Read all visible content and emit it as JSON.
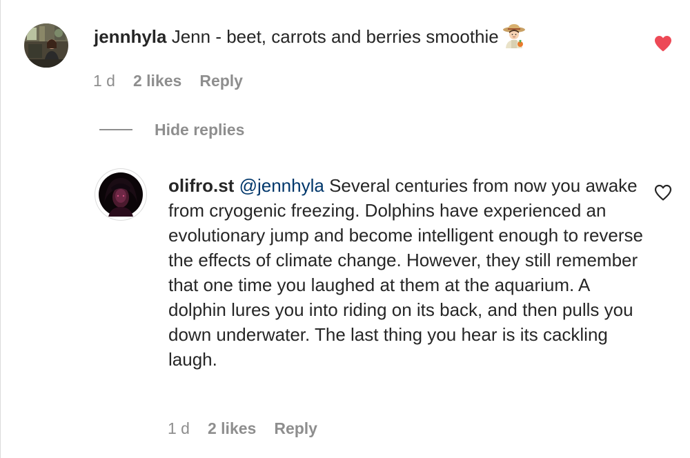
{
  "comments": [
    {
      "username": "jennhyla",
      "text": "Jenn - beet, carrots and berries smoothie",
      "emoji_icon": "farmer-emoji-icon",
      "time": "1 d",
      "likes": "2 likes",
      "reply_label": "Reply",
      "liked": true,
      "like_color": "#ed4956"
    }
  ],
  "replies_toggle": {
    "label": "Hide replies"
  },
  "replies": [
    {
      "username": "olifro.st",
      "mention": "@jennhyla",
      "text": "Several centuries from now you awake from cryogenic freezing. Dolphins have experienced an evolutionary jump and become intelligent enough to reverse the effects of climate change. However, they still remember that one time you laughed at them at the aquarium. A dolphin lures you into riding on its back, and then pulls you down underwater. The last thing you hear is its cackling laugh.",
      "time": "1 d",
      "likes": "2 likes",
      "reply_label": "Reply",
      "liked": false
    }
  ],
  "colors": {
    "text": "#262626",
    "secondary": "#8e8e8e",
    "mention": "#00376b",
    "like": "#ed4956"
  }
}
